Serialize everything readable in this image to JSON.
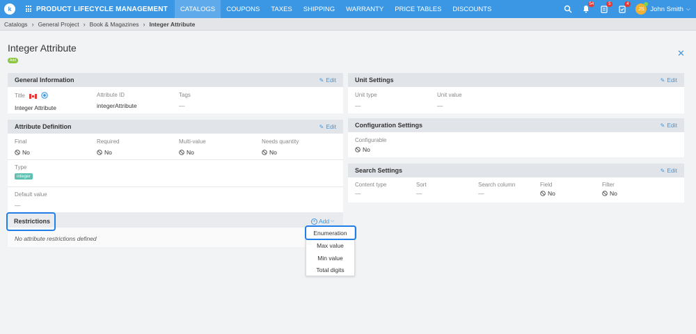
{
  "nav": {
    "logo": "k",
    "app_title": "PRODUCT LIFECYCLE MANAGEMENT",
    "items": [
      "CATALOGS",
      "COUPONS",
      "TAXES",
      "SHIPPING",
      "WARRANTY",
      "PRICE TABLES",
      "DISCOUNTS"
    ],
    "active": "CATALOGS",
    "badges": {
      "bell": "54",
      "tasks": "5",
      "checklist": "4"
    },
    "user_name": "John Smith",
    "user_initials": "JS"
  },
  "breadcrumb": [
    "Catalogs",
    "General Project",
    "Book & Magazines",
    "Integer Attribute"
  ],
  "page": {
    "title": "Integer Attribute",
    "status_pill": "Add"
  },
  "general_info": {
    "title": "General Information",
    "edit": "Edit",
    "title_label": "Title",
    "title_value": "Integer Attribute",
    "attr_id_label": "Attribute ID",
    "attr_id_value": "integerAttribute",
    "tags_label": "Tags",
    "tags_value": "—"
  },
  "attr_def": {
    "title": "Attribute Definition",
    "edit": "Edit",
    "final_label": "Final",
    "final_value": "No",
    "required_label": "Required",
    "required_value": "No",
    "multi_label": "Multi-value",
    "multi_value": "No",
    "qty_label": "Needs quantity",
    "qty_value": "No",
    "type_label": "Type",
    "type_value": "integer",
    "default_label": "Default value",
    "default_value": "—"
  },
  "restrictions": {
    "title": "Restrictions",
    "add": "Add",
    "empty": "No attribute restrictions defined",
    "menu": [
      "Enumeration",
      "Max value",
      "Min value",
      "Total digits"
    ]
  },
  "unit_settings": {
    "title": "Unit Settings",
    "edit": "Edit",
    "type_label": "Unit type",
    "type_value": "—",
    "value_label": "Unit value",
    "value_value": "—"
  },
  "config_settings": {
    "title": "Configuration Settings",
    "edit": "Edit",
    "configurable_label": "Configurable",
    "configurable_value": "No"
  },
  "search_settings": {
    "title": "Search Settings",
    "edit": "Edit",
    "content_label": "Content type",
    "content_value": "—",
    "sort_label": "Sort",
    "sort_value": "—",
    "column_label": "Search column",
    "column_value": "—",
    "field_label": "Field",
    "field_value": "No",
    "filter_label": "Filter",
    "filter_value": "No"
  },
  "colors": {
    "primary": "#3b97e3",
    "highlight": "#1f7ee8",
    "pill": "#8cc63f",
    "type_tag": "#5bc0b0"
  }
}
